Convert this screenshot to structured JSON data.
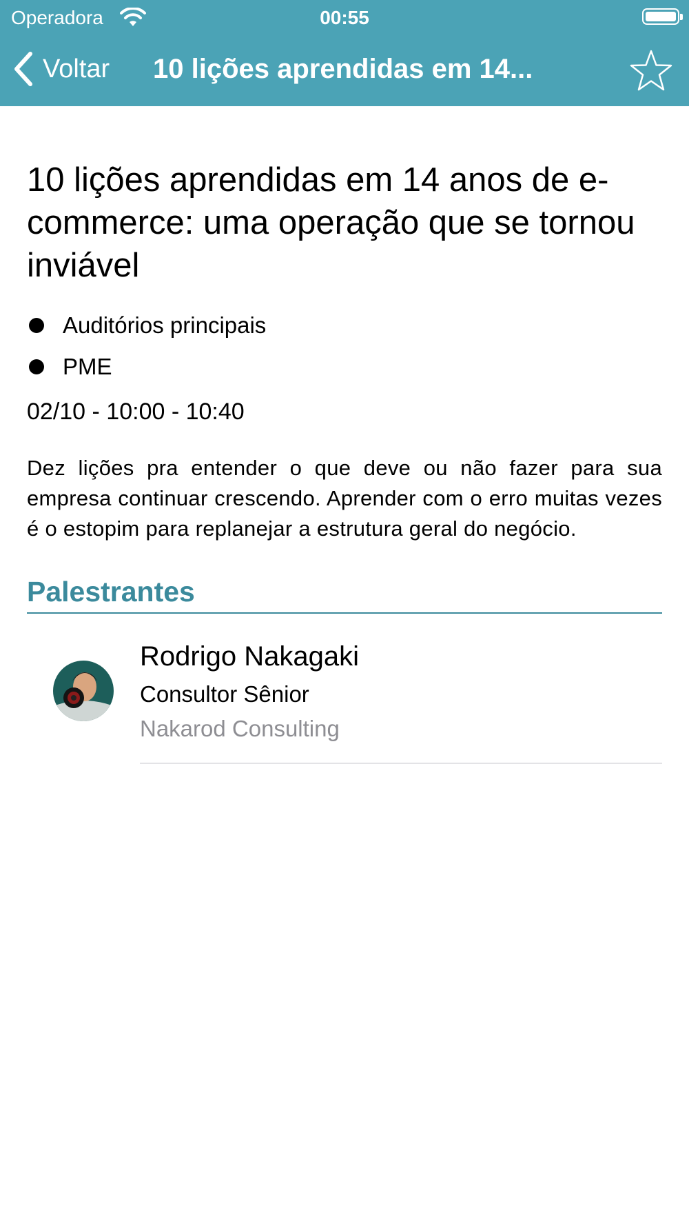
{
  "status_bar": {
    "carrier": "Operadora",
    "time": "00:55"
  },
  "nav": {
    "back_label": "Voltar",
    "title": "10 lições aprendidas em 14...",
    "star_icon": "star-outline-icon"
  },
  "session": {
    "title": "10 lições aprendidas em 14 anos de e-commerce: uma operação que se tornou inviável",
    "tags": [
      "Auditórios principais",
      "PME"
    ],
    "when": "02/10 - 10:00 - 10:40",
    "description": "Dez lições pra entender o que deve ou não fazer para sua empresa continuar crescendo. Aprender com o erro muitas vezes é o estopim para replanejar a estrutura geral do negócio."
  },
  "speakers_section": {
    "title": "Palestrantes",
    "speakers": [
      {
        "name": "Rodrigo Nakagaki",
        "role": "Consultor Sênior",
        "company": "Nakarod Consulting"
      }
    ]
  },
  "colors": {
    "accent": "#4ba3b6",
    "section": "#3b8a9c",
    "muted": "#8e8e93"
  }
}
